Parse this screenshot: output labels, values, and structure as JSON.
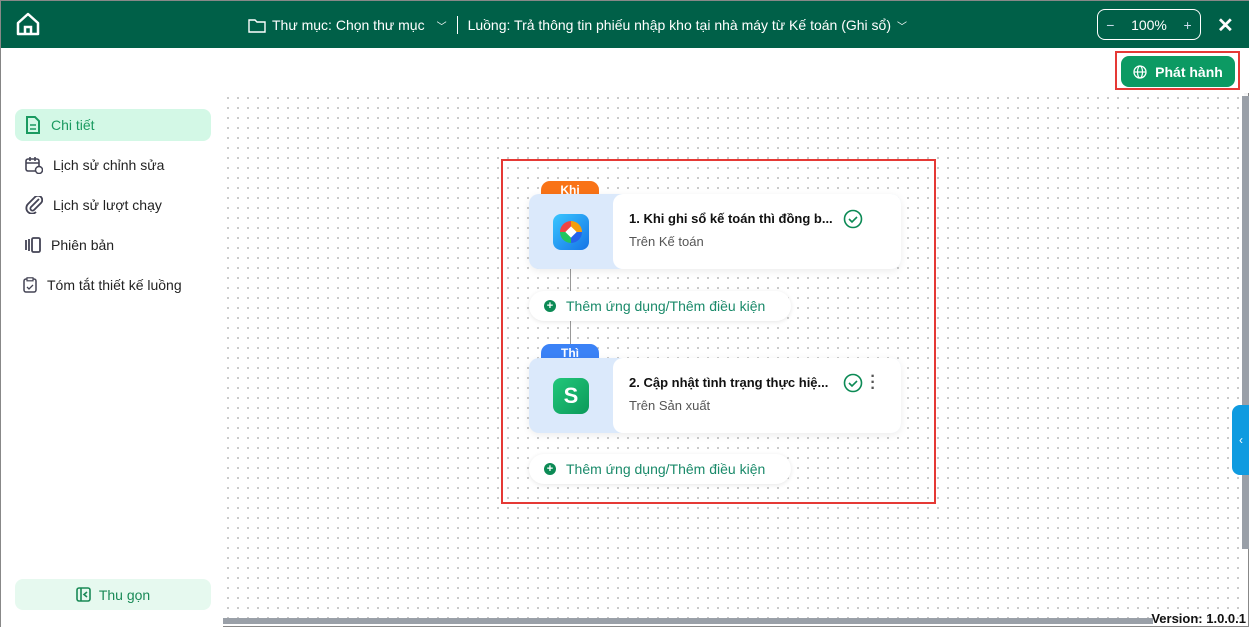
{
  "header": {
    "folder_label": "Thư mục: Chọn thư mục",
    "flow_label": "Luồng: Trả thông tin phiếu nhập kho tại nhà máy từ Kế toán (Ghi sổ)",
    "zoom": "100%",
    "zoom_minus": "−",
    "zoom_plus": "+",
    "close": "✕"
  },
  "toolbar": {
    "publish_label": "Phát hành"
  },
  "sidebar": {
    "items": [
      {
        "label": "Chi tiết"
      },
      {
        "label": "Lịch sử chỉnh sửa"
      },
      {
        "label": "Lịch sử lượt chạy"
      },
      {
        "label": "Phiên bản"
      },
      {
        "label": "Tóm tắt thiết kế luồng"
      }
    ],
    "collapse_label": "Thu gọn"
  },
  "flow": {
    "steps": [
      {
        "tag": "Khi",
        "title": "1.  Khi ghi sổ kế toán thì đồng b...",
        "subtitle": "Trên Kế toán",
        "tag_color": "#f97316"
      },
      {
        "tag": "Thì",
        "title": "2.  Cập nhật tình trạng thực hiệ...",
        "subtitle": "Trên Sản xuất",
        "tag_color": "#3b82f6"
      }
    ],
    "add_label": "Thêm ứng dụng/Thêm điều kiện"
  },
  "footer": {
    "version": "Version: 1.0.0.1"
  },
  "panel_toggle": "‹"
}
